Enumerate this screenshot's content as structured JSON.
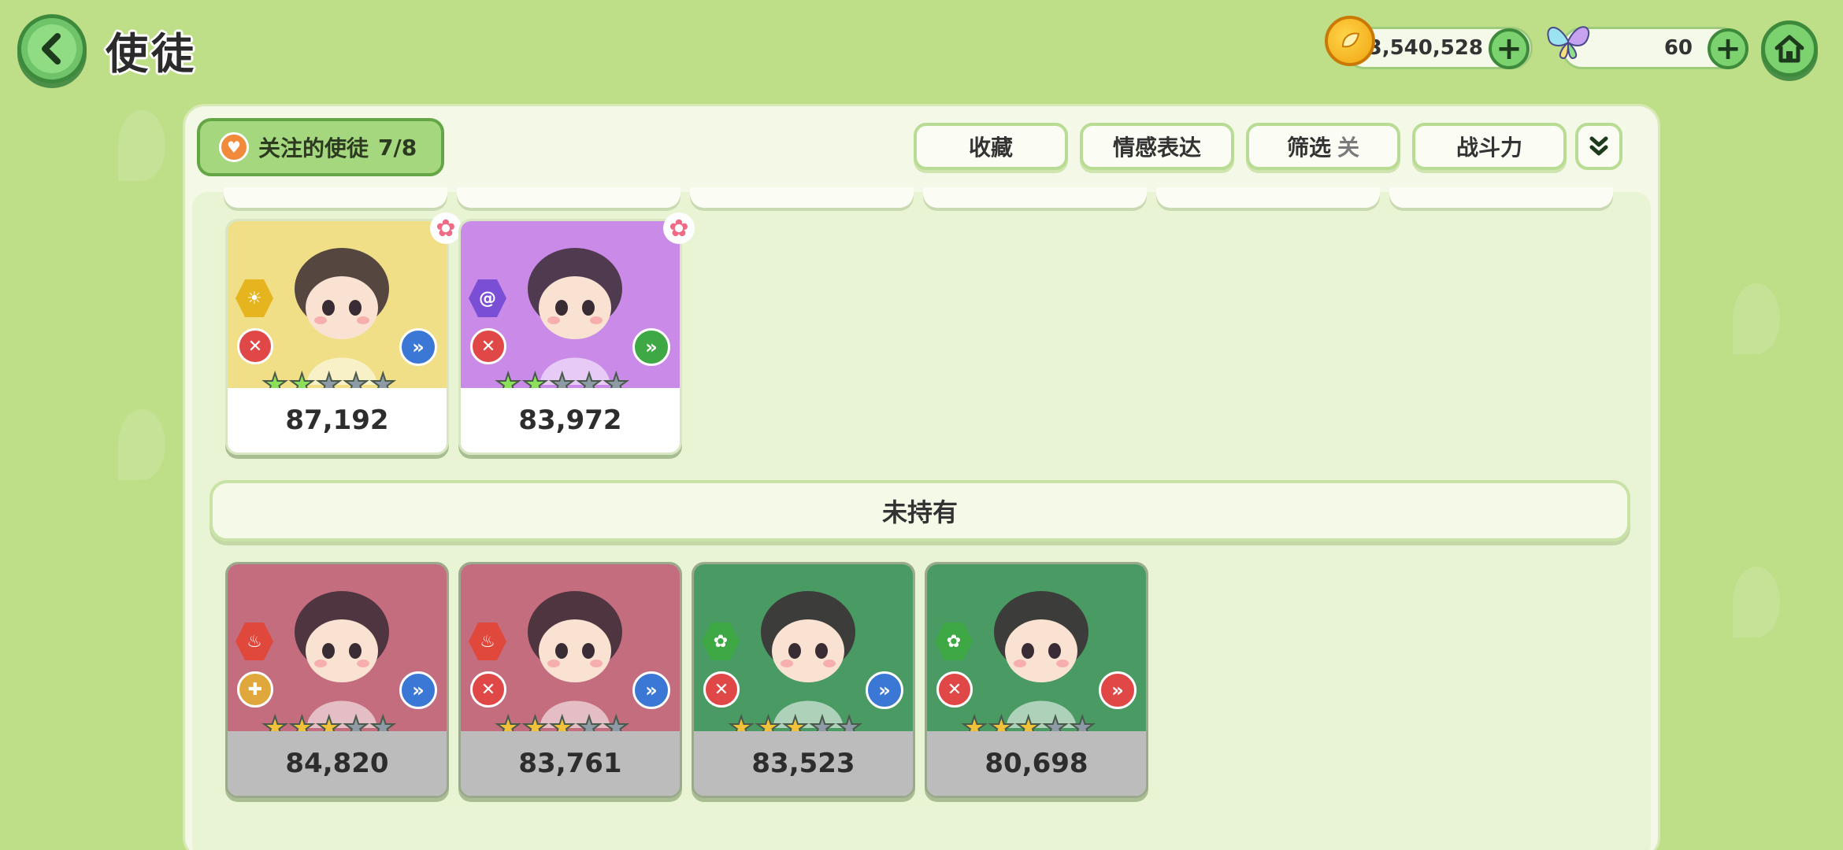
{
  "header": {
    "title": "使徒",
    "gold": "3,540,528",
    "gems": "60"
  },
  "toolbar": {
    "follow_label": "关注的使徒",
    "follow_count": "7/8",
    "buttons": [
      "收藏",
      "情感表达",
      "筛选",
      "战斗力"
    ],
    "filter_state": "关"
  },
  "section": {
    "unowned_label": "未持有"
  },
  "owned_cards": [
    {
      "power": "87,192",
      "bg": "#f0df86",
      "attr_color": "#e6b41e",
      "role_color": "#e04848",
      "pos_color": "#3b78d6",
      "stars": [
        "g",
        "g",
        "e",
        "e",
        "e"
      ],
      "attribute": "sun-icon",
      "role": "attack-icon",
      "position": "forward-icon"
    },
    {
      "power": "83,972",
      "bg": "#c98ae8",
      "attr_color": "#7a4fd6",
      "role_color": "#e04848",
      "pos_color": "#3ea844",
      "stars": [
        "g",
        "g",
        "e",
        "e",
        "e"
      ],
      "attribute": "swirl-icon",
      "role": "attack-icon",
      "position": "forward-icon"
    }
  ],
  "unowned_cards": [
    {
      "power": "84,820",
      "bg": "#c46d7e",
      "attr_color": "#e0483c",
      "role_color": "#e0a83c",
      "pos_color": "#3b78d6",
      "stars": [
        "y",
        "y",
        "y",
        "e",
        "e"
      ],
      "attribute": "fire-icon",
      "role": "support-icon",
      "position": "forward-icon"
    },
    {
      "power": "83,761",
      "bg": "#c46d7e",
      "attr_color": "#e0483c",
      "role_color": "#e04848",
      "pos_color": "#3b78d6",
      "stars": [
        "y",
        "y",
        "y",
        "e",
        "e"
      ],
      "attribute": "fire-icon",
      "role": "attack-icon",
      "position": "forward-icon"
    },
    {
      "power": "83,523",
      "bg": "#4a9a64",
      "attr_color": "#3ea844",
      "role_color": "#e04848",
      "pos_color": "#3b78d6",
      "stars": [
        "y",
        "y",
        "y",
        "e",
        "e"
      ],
      "attribute": "leaf-icon",
      "role": "attack-icon",
      "position": "forward-icon"
    },
    {
      "power": "80,698",
      "bg": "#4a9a64",
      "attr_color": "#3ea844",
      "role_color": "#e04848",
      "pos_color": "#e04848",
      "stars": [
        "y",
        "y",
        "y",
        "e",
        "e"
      ],
      "attribute": "leaf-icon",
      "role": "attack-icon",
      "position": "forward-icon"
    }
  ]
}
